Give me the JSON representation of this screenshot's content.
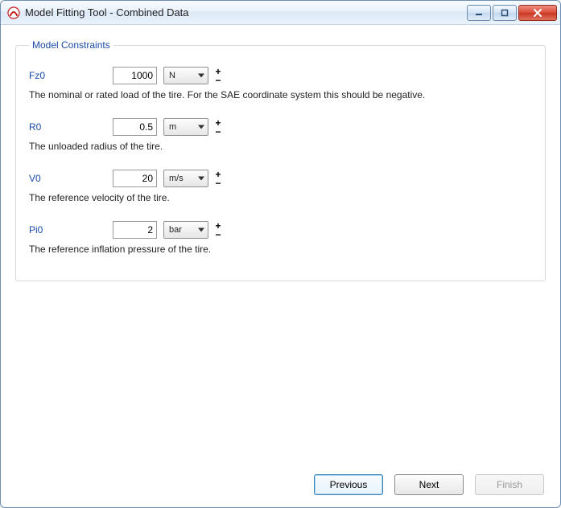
{
  "window": {
    "title": "Model Fitting Tool - Combined Data"
  },
  "group": {
    "legend": "Model Constraints"
  },
  "params": {
    "fz0": {
      "label": "Fz0",
      "value": "1000",
      "unit": "N",
      "desc": "The nominal or rated load of the tire. For the SAE coordinate system this should be negative."
    },
    "r0": {
      "label": "R0",
      "value": "0.5",
      "unit": "m",
      "desc": "The unloaded radius of the tire."
    },
    "v0": {
      "label": "V0",
      "value": "20",
      "unit": "m/s",
      "desc": "The reference velocity of the tire."
    },
    "pi0": {
      "label": "Pi0",
      "value": "2",
      "unit": "bar",
      "desc": "The reference inflation pressure of the tire."
    }
  },
  "buttons": {
    "previous": "Previous",
    "next": "Next",
    "finish": "Finish"
  }
}
